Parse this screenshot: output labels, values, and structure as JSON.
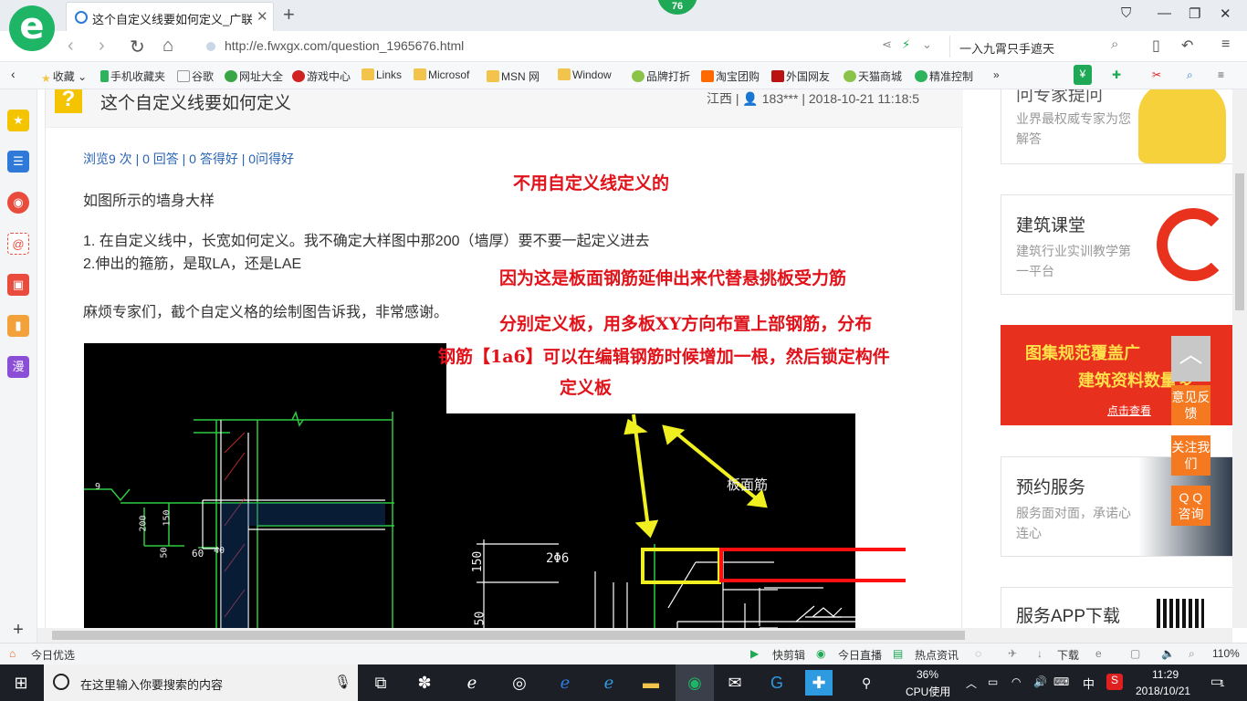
{
  "browser": {
    "badge": "76",
    "tab_title": "这个自定义线要如何定义_广联达",
    "url": "http://e.fwxgx.com/question_1965676.html",
    "search_text": "一入九霄只手遮天",
    "bookmarks": [
      "收藏",
      "手机收藏夹",
      "谷歌",
      "网址大全",
      "游戏中心",
      "Links",
      "Microsof",
      "MSN 网",
      "Window",
      "品牌打折",
      "淘宝团购",
      "外国网友",
      "天猫商城",
      "精准控制"
    ]
  },
  "sidebar_icons": [
    "star-icon",
    "news-icon",
    "weibo-icon",
    "mail-icon",
    "game-icon",
    "book-icon",
    "comic-icon"
  ],
  "sidebar_comic_label": "漫",
  "question": {
    "title": "这个自定义线要如何定义",
    "meta": "江西 | ",
    "user": "183***",
    "datetime": " | 2018-10-21 11:18:5",
    "stats": "浏览9 次 | 0 回答 | 0 答得好 | 0问得好",
    "body": [
      "如图所示的墙身大样",
      "1. 在自定义线中，长宽如何定义。我不确定大样图中那200（墙厚）要不要一起定义进去",
      "2.伸出的箍筋，是取LA，还是LAE",
      "麻烦专家们，截个自定义格的绘制图告诉我，非常感谢。"
    ]
  },
  "annotations": [
    "不用自定义线定义的",
    "因为这是板面钢筋延伸出来代替悬挑板受力筋",
    "分别定义板，用多板XY方向布置上部钢筋，分布",
    "钢筋【1a6】可以在编辑钢筋时候增加一根，然后锁定构件",
    "定义板"
  ],
  "cad_labels": {
    "slab_rebar": "板面筋",
    "rebar": "2Φ6",
    "dim_150a": "150",
    "dim_150b": "150",
    "dim_200": "200",
    "dim_50a": "50",
    "dim_50b": "50",
    "dim_60": "60",
    "dim_40": "40",
    "dim_9": "9"
  },
  "right_sidebar": {
    "expert": {
      "title": "问专家提问",
      "desc": "业界最权威专家为您解答"
    },
    "course": {
      "title": "建筑课堂",
      "desc": "建筑行业实训教学第一平台"
    },
    "banner": {
      "line1": "图集规范覆盖广",
      "line2": "建筑资料数量多",
      "cta": "点击查看"
    },
    "booking": {
      "title": "预约服务",
      "desc": "服务面对面，承诺心连心"
    },
    "app": {
      "title": "服务APP下载"
    }
  },
  "float_buttons": [
    "意见反馈",
    "关注我们",
    "Q Q 咨询"
  ],
  "status_bar": {
    "left": "今日优选",
    "items": [
      "快剪辑",
      "今日直播",
      "热点资讯",
      "下载"
    ],
    "zoom": "110%"
  },
  "taskbar": {
    "search_placeholder": "在这里输入你要搜索的内容",
    "cpu_percent": "36%",
    "cpu_label": "CPU使用",
    "ime": "中",
    "time": "11:29",
    "date": "2018/10/21",
    "notification_count": "1"
  },
  "colors": {
    "annotation_red": "#e0121a",
    "link_blue": "#2a64b4",
    "float_orange": "#f47920",
    "logo_green": "#1fb566"
  }
}
